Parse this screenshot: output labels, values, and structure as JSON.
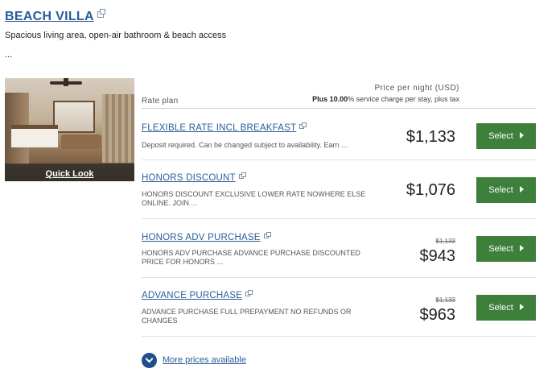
{
  "room": {
    "title": "BEACH VILLA",
    "description": "Spacious living area, open-air bathroom & beach access",
    "more_text": "...",
    "quick_look_label": "Quick Look"
  },
  "table_header": {
    "rate_plan_label": "Rate plan",
    "price_label": "Price per night (USD)",
    "service_prefix": "Plus 10.00",
    "service_suffix": "% service charge per stay, plus tax"
  },
  "rates": [
    {
      "name": "FLEXIBLE RATE INCL BREAKFAST",
      "description": "Deposit required. Can be changed subject to availability. Earn ...",
      "original_price": "",
      "price": "$1,133",
      "button": "Select"
    },
    {
      "name": "HONORS DISCOUNT",
      "description": "HONORS DISCOUNT EXCLUSIVE LOWER RATE NOWHERE ELSE ONLINE. JOIN ...",
      "original_price": "",
      "price": "$1,076",
      "button": "Select"
    },
    {
      "name": "HONORS ADV PURCHASE",
      "description": "HONORS ADV PURCHASE ADVANCE PURCHASE DISCOUNTED PRICE FOR HONORS ...",
      "original_price": "$1,133",
      "price": "$943",
      "button": "Select"
    },
    {
      "name": "ADVANCE PURCHASE",
      "description": "ADVANCE PURCHASE FULL PREPAYMENT NO REFUNDS OR CHANGES",
      "original_price": "$1,133",
      "price": "$963",
      "button": "Select"
    }
  ],
  "more_prices_label": "More prices available",
  "colors": {
    "link": "#2a5c9a",
    "select_button": "#3d7f3b",
    "chevron_circle": "#1f4e8c"
  },
  "icons": [
    "external-link-icon",
    "chevron-down-icon",
    "arrow-right-icon"
  ]
}
